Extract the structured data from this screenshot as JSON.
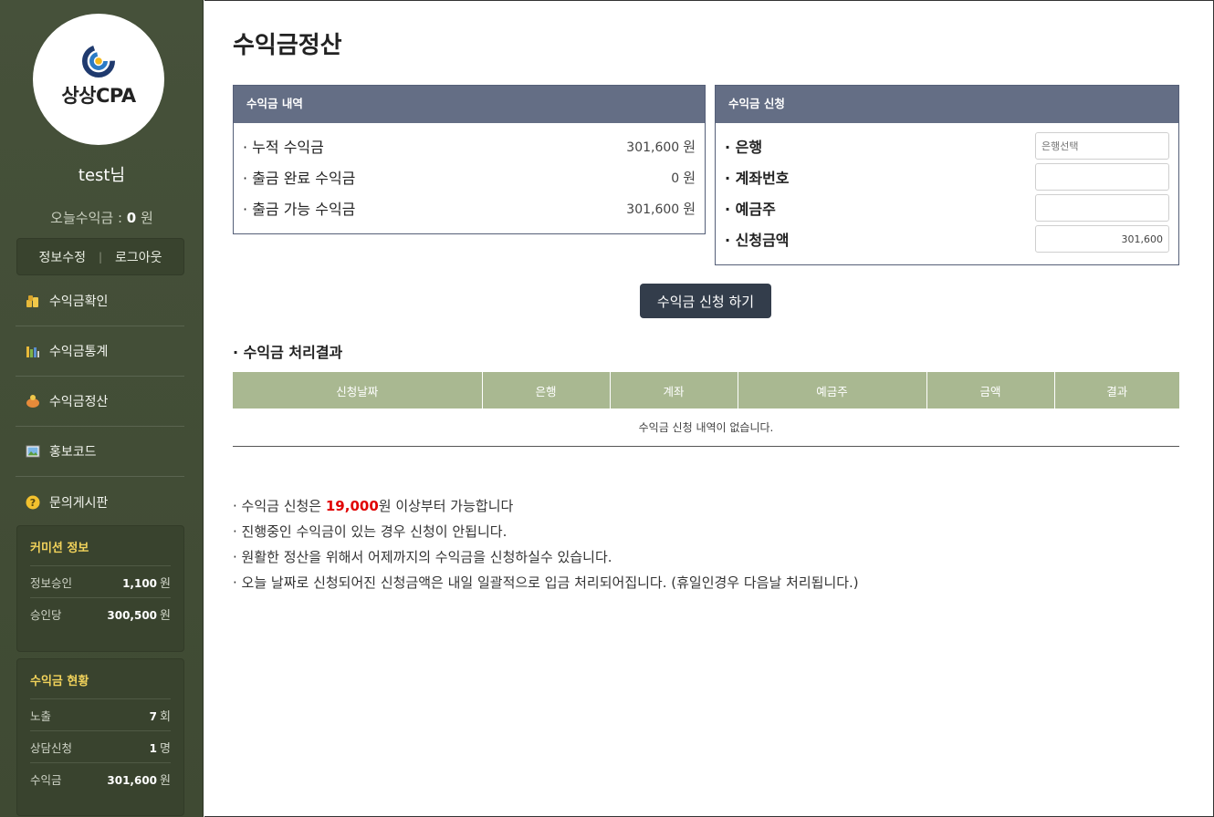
{
  "sidebar": {
    "logo_text": "상상CPA",
    "user_name": "test님",
    "today_label": "오늘수익금 :",
    "today_value": "0",
    "today_unit": "원",
    "account_edit": "정보수정",
    "account_sep": "|",
    "logout": "로그아웃",
    "menu": [
      {
        "label": "수익금확인",
        "icon": "coins-icon"
      },
      {
        "label": "수익금통계",
        "icon": "bar-chart-icon"
      },
      {
        "label": "수익금정산",
        "icon": "piggy-bank-icon"
      },
      {
        "label": "홍보코드",
        "icon": "image-icon"
      },
      {
        "label": "문의게시판",
        "icon": "question-icon"
      }
    ],
    "commission": {
      "title": "커미션 정보",
      "rows": [
        {
          "label": "정보승인",
          "value": "1,100",
          "unit": "원"
        },
        {
          "label": "승인당",
          "value": "300,500",
          "unit": "원"
        }
      ]
    },
    "earnings": {
      "title": "수익금 현황",
      "rows": [
        {
          "label": "노출",
          "value": "7",
          "unit": "회"
        },
        {
          "label": "상담신청",
          "value": "1",
          "unit": "명"
        },
        {
          "label": "수익금",
          "value": "301,600",
          "unit": "원"
        }
      ]
    }
  },
  "main": {
    "title": "수익금정산",
    "history_panel": {
      "title": "수익금 내역",
      "rows": [
        {
          "label": "· 누적 수익금",
          "value": "301,600",
          "unit": "원"
        },
        {
          "label": "· 출금 완료 수익금",
          "value": "0",
          "unit": "원"
        },
        {
          "label": "· 출금 가능 수익금",
          "value": "301,600",
          "unit": "원"
        }
      ]
    },
    "request_panel": {
      "title": "수익금 신청",
      "bank_label": "· 은행",
      "bank_placeholder": "은행선택",
      "account_label": "· 계좌번호",
      "account_value": "",
      "holder_label": "· 예금주",
      "holder_value": "",
      "amount_label": "· 신청금액",
      "amount_value": "301,600"
    },
    "submit_label": "수익금 신청 하기",
    "result_title": "· 수익금 처리결과",
    "table": {
      "headers": [
        "신청날짜",
        "은행",
        "계좌",
        "예금주",
        "금액",
        "결과"
      ],
      "empty_message": "수익금 신청 내역이 없습니다."
    },
    "notes": {
      "n1_prefix": "· 수익금 신청은 ",
      "n1_highlight": "19,000",
      "n1_suffix": "원 이상부터 가능합니다",
      "n2": "· 진행중인 수익금이 있는 경우 신청이 안됩니다.",
      "n3": "· 원활한 정산을 위해서 어제까지의 수익금을 신청하실수 있습니다.",
      "n4": "· 오늘 날짜로 신청되어진 신청금액은 내일 일괄적으로 입금 처리되어집니다. (휴일인경우 다음날 처리됩니다.)"
    },
    "colors": {
      "sidebar_bg": "#46513a",
      "panel_head": "#646e85",
      "table_head": "#a9b891",
      "button": "#333d4b",
      "highlight": "#e00000",
      "stat_title": "#f2d35b"
    }
  }
}
